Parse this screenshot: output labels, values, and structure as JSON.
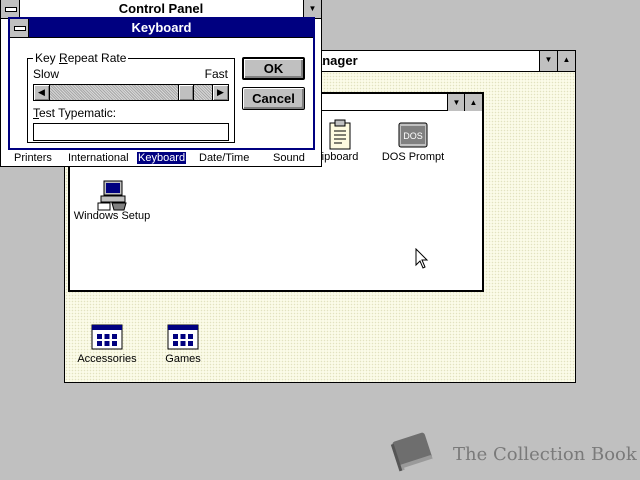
{
  "program_manager": {
    "title": "Program Manager",
    "title_visible": "anager",
    "minimize_glyph": "▼",
    "maximize_glyph": "▲",
    "groups": [
      {
        "label": "Accessories",
        "icon": "program-group-icon"
      },
      {
        "label": "Games",
        "icon": "program-group-icon"
      }
    ]
  },
  "main_group": {
    "minimize_glyph": "▼",
    "maximize_glyph": "▲",
    "icons": [
      {
        "label": "ipboard",
        "icon": "clipboard-icon"
      },
      {
        "label": "DOS Prompt",
        "icon": "dos-prompt-icon"
      },
      {
        "label": "Windows Setup",
        "icon": "windows-setup-icon"
      }
    ]
  },
  "control_panel": {
    "title": "Control Panel",
    "minimize_glyph": "▼",
    "icons": [
      {
        "label": "Printers"
      },
      {
        "label": "International"
      },
      {
        "label": "Keyboard",
        "selected": true
      },
      {
        "label": "Date/Time"
      },
      {
        "label": "Sound"
      }
    ]
  },
  "keyboard_dialog": {
    "title": "Keyboard",
    "group_label_pre": "Key ",
    "group_label_key": "R",
    "group_label_post": "epeat Rate",
    "slow_label": "Slow",
    "fast_label": "Fast",
    "repeat_rate": 0.88,
    "left_arrow": "◀",
    "right_arrow": "▶",
    "test_label_key": "T",
    "test_label_post": "est Typematic:",
    "test_value": "",
    "ok_label": "OK",
    "cancel_label": "Cancel"
  },
  "watermark": {
    "text": "The Collection Book",
    "color": "#7a7a7a"
  }
}
